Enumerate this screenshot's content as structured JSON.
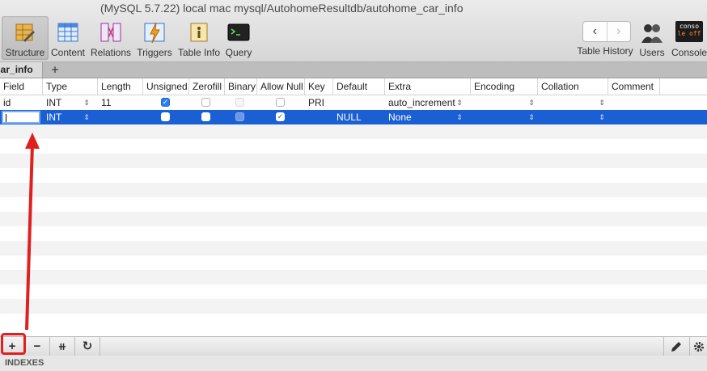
{
  "window": {
    "title": "(MySQL 5.7.22) local mac mysql/AutohomeResultdb/autohome_car_info"
  },
  "toolbar": {
    "left_items": [
      {
        "label": "Structure",
        "icon": "structure-icon",
        "active": true
      },
      {
        "label": "Content",
        "icon": "content-icon"
      },
      {
        "label": "Relations",
        "icon": "relations-icon"
      },
      {
        "label": "Triggers",
        "icon": "triggers-icon"
      },
      {
        "label": "Table Info",
        "icon": "table-info-icon"
      },
      {
        "label": "Query",
        "icon": "query-icon"
      }
    ],
    "table_history": "Table History",
    "users": "Users",
    "console": "Console",
    "console_badge_top": "conso",
    "console_badge_bottom": "le off",
    "back_glyph": "‹",
    "forward_glyph": "›"
  },
  "tabs": {
    "active": "car_info",
    "add_glyph": "+"
  },
  "table": {
    "columns": [
      "Field",
      "Type",
      "Length",
      "Unsigned",
      "Zerofill",
      "Binary",
      "Allow Null",
      "Key",
      "Default",
      "Extra",
      "Encoding",
      "Collation",
      "Comment"
    ],
    "rows": [
      {
        "field": "id",
        "type": "INT",
        "length": "11",
        "unsigned": true,
        "zerofill": false,
        "binary": false,
        "allow_null": false,
        "key": "PRI",
        "default": "",
        "extra": "auto_increment",
        "encoding": "",
        "collation": "",
        "comment": ""
      },
      {
        "field": "",
        "type": "INT",
        "length": "",
        "unsigned": false,
        "zerofill": false,
        "binary": false,
        "allow_null": true,
        "key": "",
        "default": "NULL",
        "extra": "None",
        "encoding": "",
        "collation": "",
        "comment": ""
      }
    ]
  },
  "bottom_bar": {
    "add": "+",
    "remove": "−",
    "duplicate": "⧺",
    "refresh": "↻"
  },
  "indexes_label": "INDEXES",
  "colors": {
    "selection": "#1a5fd3",
    "highlight": "#e02020"
  }
}
